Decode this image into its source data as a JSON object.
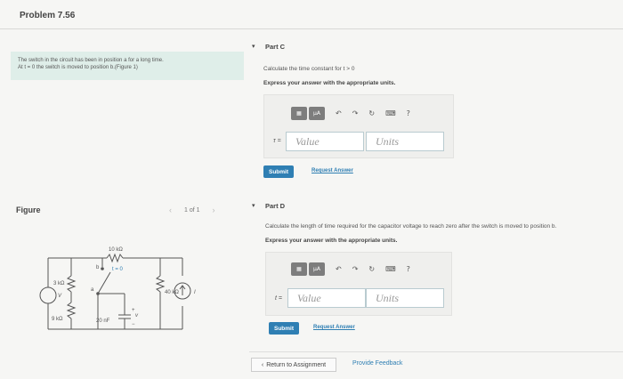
{
  "header": {
    "title": "Problem 7.56"
  },
  "problem": {
    "line1": "The switch in the circuit has been in position a for a long time.",
    "line2": "At t = 0 the switch is moved to position b.(Figure 1)"
  },
  "figure": {
    "label": "Figure",
    "pager": "1 of 1",
    "prev_icon": "chevron-left",
    "next_icon": "chevron-right",
    "labels": {
      "r_top": "10 kΩ",
      "r_left": "3 kΩ",
      "r_bottom": "9 kΩ",
      "r_right": "40 kΩ",
      "cap": "20 nF",
      "src_v": "V",
      "src_i": "I",
      "node_a": "a",
      "node_b": "b",
      "switch_t": "t = 0",
      "cap_vc": "v",
      "plus": "+",
      "minus": "−"
    }
  },
  "part_c": {
    "title": "Part C",
    "question": "Calculate the time constant for t > 0",
    "instruction": "Express your answer with the appropriate units.",
    "var_label": "τ =",
    "value_placeholder": "Value",
    "units_placeholder": "Units",
    "submit": "Submit",
    "request": "Request Answer"
  },
  "part_d": {
    "title": "Part D",
    "question": "Calculate the length of time required for the capacitor voltage to reach zero after the switch is moved to position b.",
    "instruction": "Express your answer with the appropriate units.",
    "var_label": "t =",
    "value_placeholder": "Value",
    "units_placeholder": "Units",
    "submit": "Submit",
    "request": "Request Answer"
  },
  "toolbar": {
    "templates": "templates",
    "units": "μA",
    "undo": "↶",
    "redo": "↷",
    "reset": "↻",
    "keyboard": "⌨",
    "help": "?"
  },
  "footer": {
    "return": "Return to Assignment",
    "feedback": "Provide Feedback"
  }
}
